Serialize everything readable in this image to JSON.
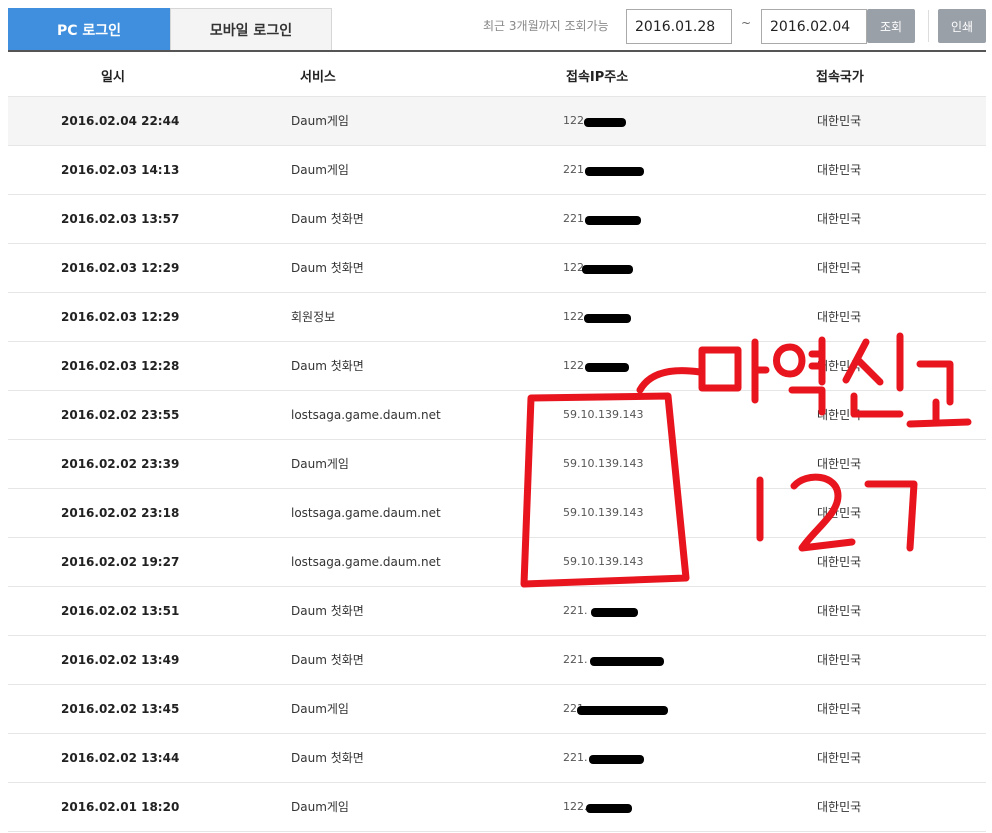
{
  "tabs": {
    "pc_login": "PC 로그인",
    "mobile_login": "모바일 로그인"
  },
  "filter": {
    "range_note": "최근 3개월까지 조회가능",
    "start_date": "2016.01.28",
    "separator": "~",
    "end_date": "2016.02.04",
    "search_label": "조회",
    "print_label": "인쇄"
  },
  "table": {
    "headers": {
      "datetime": "일시",
      "service": "서비스",
      "ip": "접속IP주소",
      "country": "접속국가"
    },
    "rows": [
      {
        "datetime": "2016.02.04 22:44",
        "service": "Daum게임",
        "ip": "122.",
        "country": "대한민국"
      },
      {
        "datetime": "2016.02.03 14:13",
        "service": "Daum게임",
        "ip": "221.",
        "country": "대한민국"
      },
      {
        "datetime": "2016.02.03 13:57",
        "service": "Daum 첫화면",
        "ip": "221.",
        "country": "대한민국"
      },
      {
        "datetime": "2016.02.03 12:29",
        "service": "Daum 첫화면",
        "ip": "122.",
        "country": "대한민국"
      },
      {
        "datetime": "2016.02.03 12:29",
        "service": "회원정보",
        "ip": "122.",
        "country": "대한민국"
      },
      {
        "datetime": "2016.02.03 12:28",
        "service": "Daum 첫화면",
        "ip": "122.",
        "country": "대한민국"
      },
      {
        "datetime": "2016.02.02 23:55",
        "service": "lostsaga.game.daum.net",
        "ip": "59.10.139.143",
        "country": "대한민국"
      },
      {
        "datetime": "2016.02.02 23:39",
        "service": "Daum게임",
        "ip": "59.10.139.143",
        "country": "대한민국"
      },
      {
        "datetime": "2016.02.02 23:18",
        "service": "lostsaga.game.daum.net",
        "ip": "59.10.139.143",
        "country": "대한민국"
      },
      {
        "datetime": "2016.02.02 19:27",
        "service": "lostsaga.game.daum.net",
        "ip": "59.10.139.143",
        "country": "대한민국"
      },
      {
        "datetime": "2016.02.02 13:51",
        "service": "Daum 첫화면",
        "ip": "221.",
        "country": "대한민국"
      },
      {
        "datetime": "2016.02.02 13:49",
        "service": "Daum 첫화면",
        "ip": "221.",
        "country": "대한민국"
      },
      {
        "datetime": "2016.02.02 13:45",
        "service": "Daum게임",
        "ip": "221",
        "country": "대한민국"
      },
      {
        "datetime": "2016.02.02 13:44",
        "service": "Daum 첫화면",
        "ip": "221.",
        "country": "대한민국"
      },
      {
        "datetime": "2016.02.01 18:20",
        "service": "Daum게임",
        "ip": "122.",
        "country": "대한민국"
      }
    ]
  },
  "annotation": {
    "scribble_text": "마약신고",
    "scribble_number": "127",
    "color": "#e8141e"
  }
}
